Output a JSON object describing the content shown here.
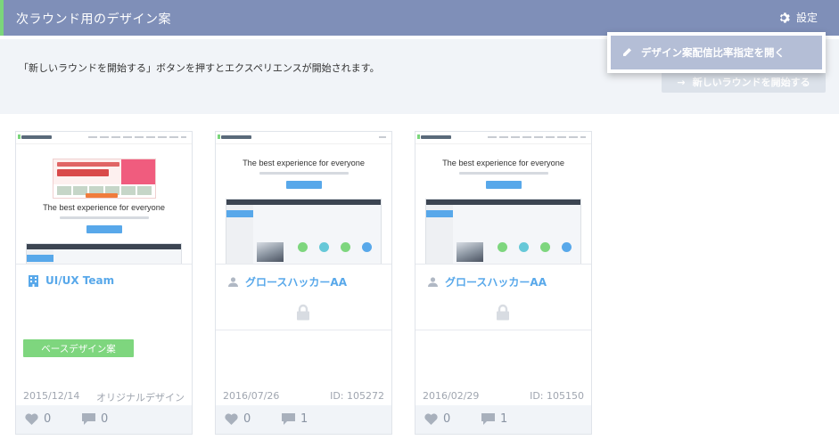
{
  "header": {
    "title": "次ラウンド用のデザイン案",
    "settings_label": "設定"
  },
  "dropdown": {
    "open_ratio_label": "デザイン案配信比率指定を開く"
  },
  "info": {
    "text": "「新しいラウンドを開始する」ボタンを押すとエクスペリエンスが開始されます。",
    "start_button": "新しいラウンドを開始する"
  },
  "thumb": {
    "headline": "The best experience for everyone"
  },
  "cards": [
    {
      "author": "UI/UX Team",
      "author_icon": "building-icon",
      "badge": "ベースデザイン案",
      "date": "2015/12/14",
      "meta": "オリジナルデザイン",
      "likes": "0",
      "comments": "0"
    },
    {
      "author": "グロースハッカーAA",
      "author_icon": "person-icon",
      "date": "2016/07/26",
      "meta": "ID: 105272",
      "likes": "0",
      "comments": "1"
    },
    {
      "author": "グロースハッカーAA",
      "author_icon": "person-icon",
      "date": "2016/02/29",
      "meta": "ID: 105150",
      "likes": "0",
      "comments": "1"
    }
  ],
  "colors": {
    "header_bg": "#7f8fb8",
    "accent_green": "#7ed67e",
    "link_blue": "#58a8ea",
    "dropdown_highlight": "#b4bed6"
  }
}
